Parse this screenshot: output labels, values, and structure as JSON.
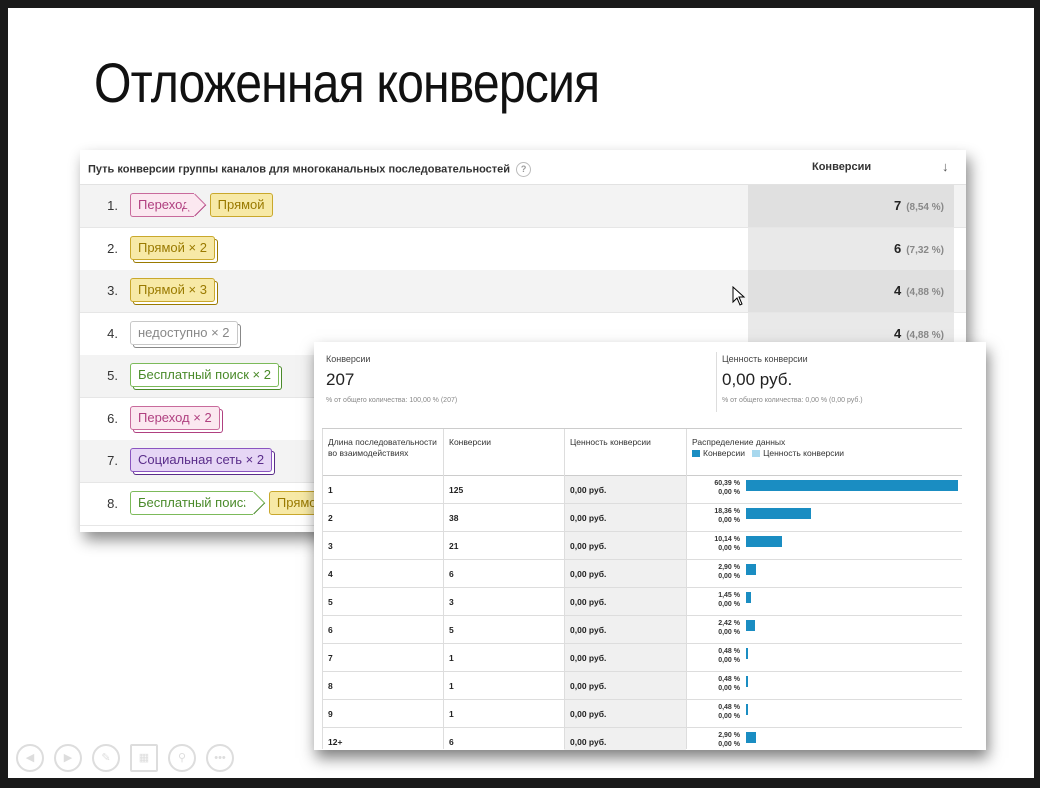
{
  "slide": {
    "title": "Отложенная конверсия"
  },
  "panel1": {
    "header": {
      "path_label": "Путь конверсии группы каналов для многоканальных последовательностей",
      "help": "?",
      "conversions_label": "Конверсии",
      "sort": "↓"
    },
    "rows": [
      {
        "num": "1.",
        "chips": [
          {
            "text": "Переход",
            "color": "pink",
            "arrow": true
          },
          {
            "text": "Прямой",
            "color": "yellow"
          }
        ],
        "value": "7",
        "pct": "(8,54 %)"
      },
      {
        "num": "2.",
        "chips": [
          {
            "text": "Прямой × 2",
            "color": "yellow",
            "stack": true
          }
        ],
        "value": "6",
        "pct": "(7,32 %)"
      },
      {
        "num": "3.",
        "chips": [
          {
            "text": "Прямой × 3",
            "color": "yellow",
            "stack": true
          }
        ],
        "value": "4",
        "pct": "(4,88 %)"
      },
      {
        "num": "4.",
        "chips": [
          {
            "text": "недоступно × 2",
            "color": "grey",
            "stack": true
          }
        ],
        "value": "4",
        "pct": "(4,88 %)"
      },
      {
        "num": "5.",
        "chips": [
          {
            "text": "Бесплатный поиск × 2",
            "color": "green",
            "stack": true
          }
        ],
        "value": "",
        "pct": ""
      },
      {
        "num": "6.",
        "chips": [
          {
            "text": "Переход × 2",
            "color": "pink",
            "stack": true
          }
        ],
        "value": "",
        "pct": ""
      },
      {
        "num": "7.",
        "chips": [
          {
            "text": "Социальная сеть × 2",
            "color": "purple",
            "stack": true
          }
        ],
        "value": "",
        "pct": ""
      },
      {
        "num": "8.",
        "chips": [
          {
            "text": "Бесплатный поиск",
            "color": "green",
            "arrow": true
          },
          {
            "text": "Прямо",
            "color": "yellow"
          }
        ],
        "value": "",
        "pct": ""
      }
    ]
  },
  "panel2": {
    "summary": [
      {
        "label": "Конверсии",
        "value": "207",
        "sub": "% от общего количества: 100,00 % (207)"
      },
      {
        "label": "Ценность конверсии",
        "value": "0,00 руб.",
        "sub": "% от общего количества: 0,00 % (0,00 руб.)"
      }
    ],
    "columns": {
      "length": "Длина последовательности во взаимодействиях",
      "conversions": "Конверсии",
      "value": "Ценность конверсии",
      "distribution": "Распределение данных"
    },
    "legend": [
      {
        "name": "Конверсии",
        "color": "#1a8dc2"
      },
      {
        "name": "Ценность конверсии",
        "color": "#a8d8ee"
      }
    ],
    "rows": [
      {
        "length": "1",
        "conversions": "125",
        "value": "0,00 руб.",
        "pct_conv": "60,39 %",
        "pct_value": "0,00 %",
        "share": 60.39
      },
      {
        "length": "2",
        "conversions": "38",
        "value": "0,00 руб.",
        "pct_conv": "18,36 %",
        "pct_value": "0,00 %",
        "share": 18.36
      },
      {
        "length": "3",
        "conversions": "21",
        "value": "0,00 руб.",
        "pct_conv": "10,14 %",
        "pct_value": "0,00 %",
        "share": 10.14
      },
      {
        "length": "4",
        "conversions": "6",
        "value": "0,00 руб.",
        "pct_conv": "2,90 %",
        "pct_value": "0,00 %",
        "share": 2.9
      },
      {
        "length": "5",
        "conversions": "3",
        "value": "0,00 руб.",
        "pct_conv": "1,45 %",
        "pct_value": "0,00 %",
        "share": 1.45
      },
      {
        "length": "6",
        "conversions": "5",
        "value": "0,00 руб.",
        "pct_conv": "2,42 %",
        "pct_value": "0,00 %",
        "share": 2.42
      },
      {
        "length": "7",
        "conversions": "1",
        "value": "0,00 руб.",
        "pct_conv": "0,48 %",
        "pct_value": "0,00 %",
        "share": 0.48
      },
      {
        "length": "8",
        "conversions": "1",
        "value": "0,00 руб.",
        "pct_conv": "0,48 %",
        "pct_value": "0,00 %",
        "share": 0.48
      },
      {
        "length": "9",
        "conversions": "1",
        "value": "0,00 руб.",
        "pct_conv": "0,48 %",
        "pct_value": "0,00 %",
        "share": 0.48
      },
      {
        "length": "12+",
        "conversions": "6",
        "value": "0,00 руб.",
        "pct_conv": "2,90 %",
        "pct_value": "0,00 %",
        "share": 2.9
      }
    ]
  },
  "nav": {
    "icons": [
      "prev-icon",
      "next-icon",
      "pen-icon",
      "slides-icon",
      "zoom-icon",
      "more-icon"
    ]
  }
}
